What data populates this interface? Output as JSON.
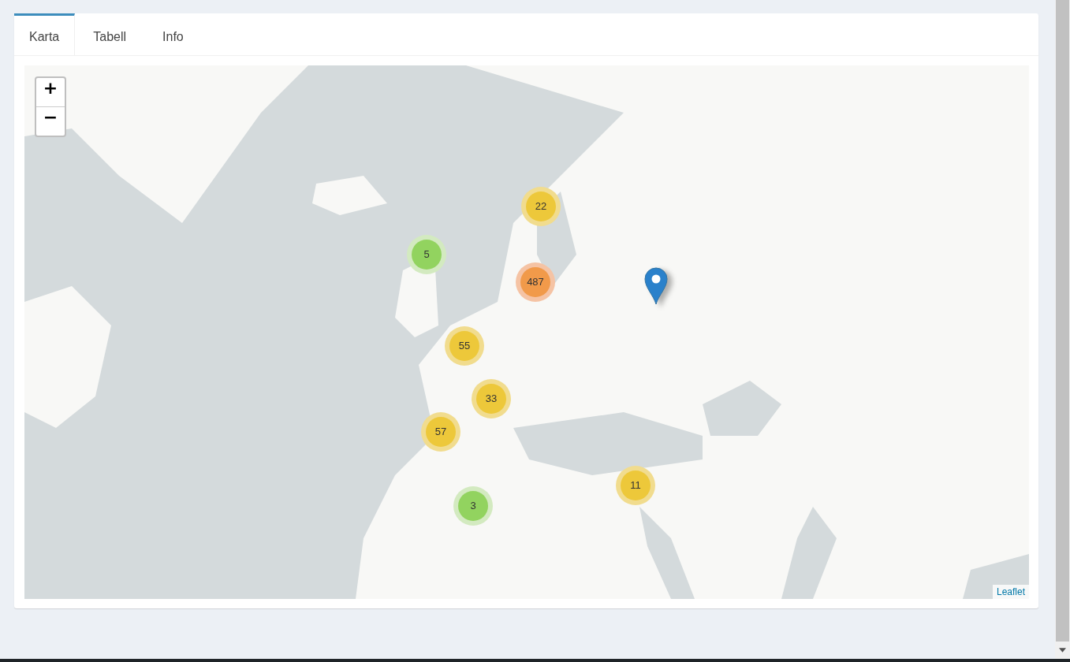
{
  "tabs": [
    {
      "label": "Karta",
      "selected": true
    },
    {
      "label": "Tabell",
      "selected": false
    },
    {
      "label": "Info",
      "selected": false
    }
  ],
  "map": {
    "kind": "picture",
    "zoom_controls": [
      "+",
      "−"
    ],
    "clusters": [
      {
        "count": "22",
        "kind": "medium"
      },
      {
        "count": "5",
        "kind": "small"
      },
      {
        "count": "487",
        "kind": "large"
      },
      {
        "count": "55",
        "kind": "medium"
      },
      {
        "count": "33",
        "kind": "medium"
      },
      {
        "count": "57",
        "kind": "medium"
      },
      {
        "count": "3",
        "kind": "small"
      },
      {
        "count": "11",
        "kind": "medium"
      }
    ],
    "pins": [
      {
        "kind": "marker"
      }
    ],
    "attribution": "Leaflet"
  }
}
